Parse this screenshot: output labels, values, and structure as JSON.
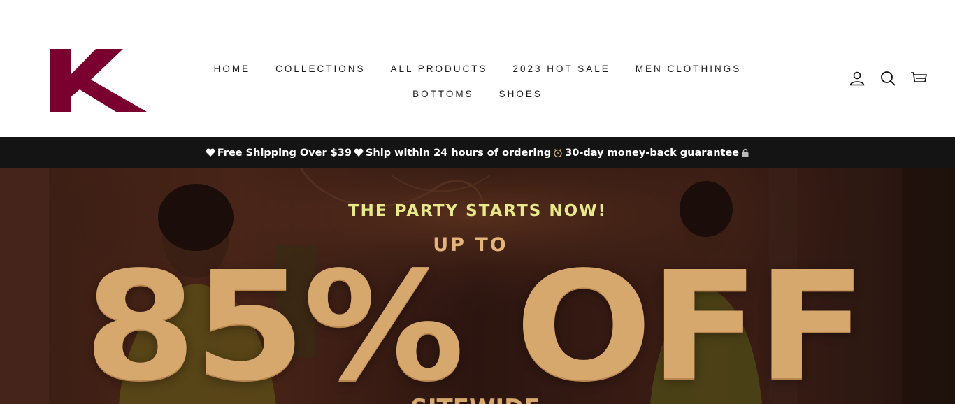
{
  "brand": {
    "logo_letter": "K",
    "logo_color": "#7a0030"
  },
  "nav": {
    "row1": [
      "HOME",
      "COLLECTIONS",
      "ALL PRODUCTS",
      "2023 HOT SALE",
      "MEN CLOTHINGS"
    ],
    "row2": [
      "BOTTOMS",
      "SHOES"
    ]
  },
  "utilities": {
    "icons": [
      "account-icon",
      "search-icon",
      "cart-icon"
    ]
  },
  "announcement": {
    "part1": "Free Shipping Over $39",
    "part2": "Ship within 24 hours of ordering",
    "part3": "30-day money-back guarantee",
    "icons": [
      "heart-icon",
      "heart-icon",
      "alarm-clock-icon",
      "lock-icon"
    ],
    "background": "#141414"
  },
  "hero": {
    "tagline": "THE PARTY STARTS NOW!",
    "subheading": "UP TO",
    "headline": "85% OFF",
    "partial_line": "SITEWIDE",
    "tagline_color": "#e7e98a",
    "gold_color": "#d7a86e"
  }
}
